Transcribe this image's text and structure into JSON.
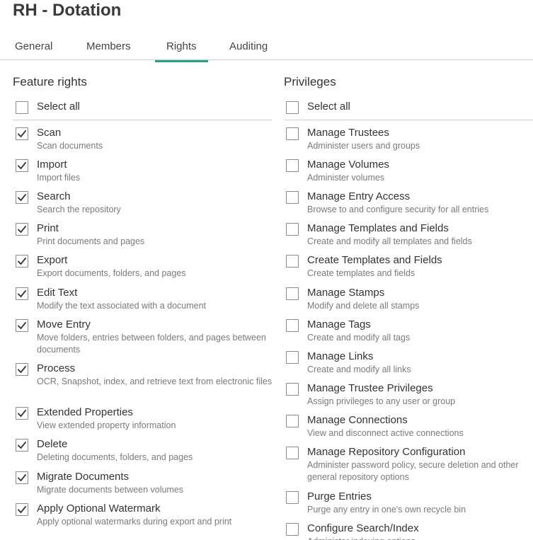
{
  "header": {
    "title": "RH - Dotation"
  },
  "tabs": [
    {
      "label": "General",
      "active": false
    },
    {
      "label": "Members",
      "active": false
    },
    {
      "label": "Rights",
      "active": true
    },
    {
      "label": "Auditing",
      "active": false
    }
  ],
  "feature_rights": {
    "title": "Feature rights",
    "select_all": {
      "label": "Select all",
      "checked": false
    },
    "items": [
      {
        "label": "Scan",
        "desc": "Scan documents",
        "checked": true
      },
      {
        "label": "Import",
        "desc": "Import files",
        "checked": true
      },
      {
        "label": "Search",
        "desc": "Search the repository",
        "checked": true
      },
      {
        "label": "Print",
        "desc": "Print documents and pages",
        "checked": true
      },
      {
        "label": "Export",
        "desc": "Export documents, folders, and pages",
        "checked": true
      },
      {
        "label": "Edit Text",
        "desc": "Modify the text associated with a document",
        "checked": true
      },
      {
        "label": "Move Entry",
        "desc": "Move folders, entries between folders, and pages between documents",
        "checked": true
      },
      {
        "label": "Process",
        "desc": "OCR, Snapshot, index, and retrieve text from electronic files",
        "checked": true
      },
      {
        "label": "Extended Properties",
        "desc": "View extended property information",
        "checked": true
      },
      {
        "label": "Delete",
        "desc": "Deleting documents, folders, and pages",
        "checked": true
      },
      {
        "label": "Migrate Documents",
        "desc": "Migrate documents between volumes",
        "checked": true
      },
      {
        "label": "Apply Optional Watermark",
        "desc": "Apply optional watermarks during export and print",
        "checked": true
      }
    ]
  },
  "privileges": {
    "title": "Privileges",
    "select_all": {
      "label": "Select all",
      "checked": false
    },
    "items": [
      {
        "label": "Manage Trustees",
        "desc": "Administer users and groups",
        "checked": false
      },
      {
        "label": "Manage Volumes",
        "desc": "Administer volumes",
        "checked": false
      },
      {
        "label": "Manage Entry Access",
        "desc": "Browse to and configure security for all entries",
        "checked": false
      },
      {
        "label": "Manage Templates and Fields",
        "desc": "Create and modify all templates and fields",
        "checked": false
      },
      {
        "label": "Create Templates and Fields",
        "desc": "Create templates and fields",
        "checked": false
      },
      {
        "label": "Manage Stamps",
        "desc": "Modify and delete all stamps",
        "checked": false
      },
      {
        "label": "Manage Tags",
        "desc": "Create and modify all tags",
        "checked": false
      },
      {
        "label": "Manage Links",
        "desc": "Create and modify all links",
        "checked": false
      },
      {
        "label": "Manage Trustee Privileges",
        "desc": "Assign privileges to any user or group",
        "checked": false
      },
      {
        "label": "Manage Connections",
        "desc": "View and disconnect active connections",
        "checked": false
      },
      {
        "label": "Manage Repository Configuration",
        "desc": "Administer password policy, secure deletion and other general repository options",
        "checked": false
      },
      {
        "label": "Purge Entries",
        "desc": "Purge any entry in one's own recycle bin",
        "checked": false
      },
      {
        "label": "Configure Search/Index",
        "desc": "Administer indexing options",
        "checked": false
      }
    ]
  },
  "colors": {
    "accent": "#26a085",
    "text": "#333333",
    "muted": "#7a7a7a",
    "border": "#8a8a8a"
  }
}
